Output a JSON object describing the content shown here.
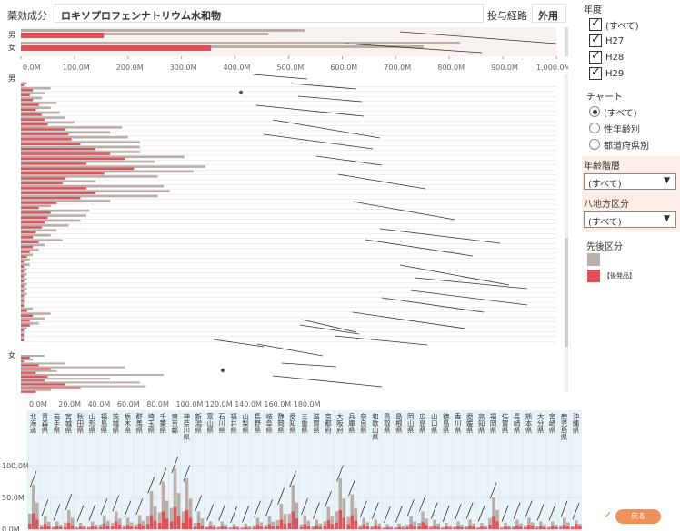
{
  "header": {
    "ingredient_label": "薬効成分",
    "ingredient_value": "ロキソプロフェンナトリウム水和物",
    "route_label": "投与経路",
    "route_value": "外用"
  },
  "top_chart": {
    "rows": [
      "男",
      "女"
    ],
    "axis_ticks": [
      "0.0M",
      "100.0M",
      "200.0M",
      "300.0M",
      "400.0M",
      "500.0M",
      "600.0M",
      "700.0M",
      "800.0M",
      "900.0M",
      "1,000.0M"
    ]
  },
  "mid_chart": {
    "rows": [
      "男",
      "女"
    ],
    "axis_ticks": [
      "0.0M",
      "20.0M",
      "40.0M",
      "60.0M",
      "80.0M",
      "100.0M",
      "120.0M",
      "140.0M",
      "160.0M",
      "180.0M"
    ]
  },
  "bottom_chart": {
    "y_ticks": [
      "100.0M",
      "50.0M",
      "0.0M"
    ],
    "prefectures": [
      "北海道",
      "青森県",
      "岩手県",
      "宮城県",
      "秋田県",
      "山形県",
      "福島県",
      "茨城県",
      "栃木県",
      "群馬県",
      "埼玉県",
      "千葉県",
      "東京都",
      "神奈川県",
      "新潟県",
      "富山県",
      "石川県",
      "福井県",
      "山梨県",
      "長野県",
      "岐阜県",
      "静岡県",
      "愛知県",
      "三重県",
      "滋賀県",
      "京都府",
      "大阪府",
      "兵庫県",
      "奈良県",
      "和歌山県",
      "鳥取県",
      "島根県",
      "岡山県",
      "広島県",
      "山口県",
      "徳島県",
      "香川県",
      "愛媛県",
      "高知県",
      "福岡県",
      "佐賀県",
      "長崎県",
      "熊本県",
      "大分県",
      "宮崎県",
      "鹿児島県",
      "沖縄県"
    ]
  },
  "chart_data": [
    {
      "type": "bar",
      "title": "",
      "categories": [
        "男",
        "女"
      ],
      "series": [
        {
          "name": "",
          "values": [
            530,
            820
          ]
        },
        {
          "name": "【後発品】",
          "values": [
            155,
            355
          ]
        }
      ],
      "xlim": [
        0,
        1000
      ]
    },
    {
      "type": "bar",
      "title": "",
      "male_total": [
        2,
        10,
        8,
        7,
        12,
        10,
        13,
        15,
        18,
        34,
        30,
        36,
        40,
        40,
        40,
        55,
        45,
        62,
        58,
        46,
        25,
        48,
        50,
        46,
        30,
        10,
        23,
        22,
        20,
        16,
        12,
        10,
        14,
        8,
        6,
        4,
        3,
        3,
        2,
        2,
        2,
        2,
        2,
        2,
        1,
        1,
        4,
        10,
        8,
        6,
        2,
        1,
        1
      ],
      "male_generic": [
        1,
        4,
        3,
        4,
        6,
        5,
        7,
        8,
        9,
        15,
        16,
        17,
        20,
        25,
        30,
        35,
        22,
        38,
        28,
        15,
        14,
        22,
        25,
        20,
        12,
        6,
        10,
        9,
        8,
        7,
        5,
        4,
        6,
        4,
        3,
        2,
        1,
        1,
        1,
        1,
        1,
        1,
        1,
        1,
        1,
        1,
        2,
        4,
        3,
        3,
        1,
        1,
        1
      ],
      "female_total": [
        8,
        4,
        15,
        35,
        12,
        48,
        30,
        40,
        42,
        10
      ],
      "female_generic": [
        3,
        1,
        6,
        10,
        5,
        9,
        8,
        15,
        20,
        5
      ],
      "xlim": [
        0,
        180
      ]
    },
    {
      "type": "bar",
      "title": "",
      "categories": [
        "北海道",
        "青森県",
        "岩手県",
        "宮城県",
        "秋田県",
        "山形県",
        "福島県",
        "茨城県",
        "栃木県",
        "群馬県",
        "埼玉県",
        "千葉県",
        "東京都",
        "神奈川県",
        "新潟県",
        "富山県",
        "石川県",
        "福井県",
        "山梨県",
        "長野県",
        "岐阜県",
        "静岡県",
        "愛知県",
        "三重県",
        "滋賀県",
        "京都府",
        "大阪府",
        "兵庫県",
        "奈良県",
        "和歌山県",
        "鳥取県",
        "島根県",
        "岡山県",
        "広島県",
        "山口県",
        "徳島県",
        "香川県",
        "愛媛県",
        "高知県",
        "福岡県",
        "佐賀県",
        "長崎県",
        "熊本県",
        "大分県",
        "宮崎県",
        "鹿児島県",
        "沖縄県"
      ],
      "total_peak": [
        70,
        20,
        12,
        30,
        10,
        12,
        22,
        28,
        18,
        22,
        60,
        75,
        95,
        80,
        28,
        12,
        12,
        8,
        9,
        18,
        20,
        40,
        70,
        22,
        15,
        35,
        80,
        55,
        18,
        15,
        8,
        9,
        20,
        28,
        15,
        10,
        12,
        15,
        10,
        50,
        10,
        15,
        18,
        12,
        12,
        18,
        14
      ],
      "generic_peak": [
        25,
        8,
        5,
        10,
        4,
        5,
        9,
        12,
        7,
        9,
        22,
        28,
        35,
        30,
        10,
        5,
        5,
        3,
        3,
        7,
        8,
        15,
        28,
        8,
        6,
        14,
        30,
        22,
        7,
        6,
        3,
        3,
        8,
        11,
        6,
        4,
        5,
        6,
        4,
        20,
        4,
        6,
        7,
        5,
        5,
        7,
        8
      ],
      "ylim": [
        0,
        150
      ]
    }
  ],
  "right_panel": {
    "year_title": "年度",
    "years": [
      {
        "label": "(すべて)",
        "checked": true
      },
      {
        "label": "H27",
        "checked": true
      },
      {
        "label": "H28",
        "checked": true
      },
      {
        "label": "H29",
        "checked": true
      }
    ],
    "chart_title": "チャート",
    "chart_options": [
      {
        "label": "(すべて)",
        "selected": true
      },
      {
        "label": "性年齢別",
        "selected": false
      },
      {
        "label": "都道府県別",
        "selected": false
      }
    ],
    "age_title": "年齢階層",
    "age_value": "(すべて)",
    "region_title": "八地方区分",
    "region_value": "(すべて)",
    "legend_title": "先後区分",
    "legend_items": [
      {
        "label": "",
        "color": "#b9aeaa"
      },
      {
        "label": "【後発品】",
        "color": "#e05258"
      }
    ],
    "back_label": "戻る"
  },
  "colors": {
    "brand_bar": "#b9aeaa",
    "generic_bar": "#e05258",
    "plot_bg": "#f7f2ee",
    "bottom_bg": "#eaf3f7"
  }
}
